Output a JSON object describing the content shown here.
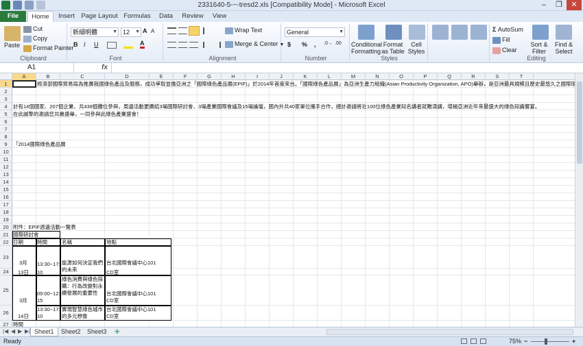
{
  "window": {
    "title": "2331640-5-~-tresd2.xls [Compatibility Mode] - Microsoft Excel",
    "minimize": "–",
    "restore": "❐",
    "close": "✕"
  },
  "tabs": {
    "file": "File",
    "home": "Home",
    "insert": "Insert",
    "page_layout": "Page Layout",
    "formulas": "Formulas",
    "data": "Data",
    "review": "Review",
    "view": "View"
  },
  "clipboard": {
    "paste": "Paste",
    "cut": "Cut",
    "copy": "Copy",
    "format_painter": "Format Painter",
    "label": "Clipboard"
  },
  "font": {
    "name": "新細明體",
    "size": "12",
    "bold": "B",
    "italic": "I",
    "underline": "U",
    "label": "Font"
  },
  "alignment": {
    "wrap": "Wrap Text",
    "merge": "Merge & Center",
    "label": "Alignment"
  },
  "number": {
    "format": "General",
    "currency": "$",
    "percent": "%",
    "comma": ",",
    "label": "Number"
  },
  "styles": {
    "conditional": "Conditional Formatting",
    "table": "Format as Table",
    "cell": "Cell Styles",
    "label": "Styles"
  },
  "cells": {
    "r1": "經濟部國際貿易局為推廣我國綠色產品及服務，成功爭取並擔亞洲之「國際綠色產品展(EPIF)」於2014年首度來台。「國際綠色產品展」為亞洲生產力組織(Asian Productivity Organization, APO)舉辦，是亞洲最具規模且歷史最悠久之國際環保展，本",
    "r4": "計有14個國家、207個企業、共438個攤位參與，周邊活動更廣結3場國際研討會、3場產業國際會議及15場論壇，國內外共40家單位攜手合作，總計邀請將近100位綠色產業知名講者就難演講，堪稱亞洲近年來最盛大的綠色知識饗宴。",
    "r5": "在此誠摯的邀請您共襄盛舉，一同參與此綠色產業盛會！",
    "r9": "「2014國際綠色產品展",
    "r20": "附件：EPIF週邊活動一覽表",
    "r21": "國際研討會",
    "h_date": "日期",
    "h_time": "時間",
    "h_name": "名稱",
    "h_place": "地點",
    "d1": "3月",
    "d2": "13日",
    "t1": "13:30~17:",
    "t1b": "10",
    "n1": "能源如何決定我們的未來",
    "p1": "台北國際會議中心101",
    "p1b": "CD室",
    "n2": "綠色消費與綠色採購：行為改變對永續發展的重要性",
    "t2": "09:00~12:",
    "t2b": "15",
    "d3": "3月",
    "p2": "台北國際會議中心101",
    "p2b": "CD室",
    "t3": "13:30~17:",
    "t3b": "10",
    "d4": "14日",
    "n3": "實現智慧綠色城市的多元想像",
    "p3": "台北國際會議中心101",
    "p3b": "CD室",
    "r27": "時間"
  },
  "editing": {
    "autosum": "AutoSum",
    "fill": "Fill",
    "clear": "Clear",
    "sort": "Sort & Filter",
    "find": "Find & Select",
    "label": "Editing"
  },
  "formula_bar": {
    "name_box": "A1",
    "fx": "fx",
    "formula": ""
  },
  "columns": [
    "A",
    "B",
    "C",
    "D",
    "E",
    "F",
    "G",
    "H",
    "I",
    "J",
    "K",
    "L",
    "M",
    "N",
    "O",
    "P",
    "Q",
    "R",
    "S",
    "T"
  ],
  "rows": [
    "1",
    "2",
    "3",
    "4",
    "5",
    "6",
    "7",
    "8",
    "9",
    "10",
    "11",
    "12",
    "13",
    "14",
    "15",
    "16",
    "17",
    "18",
    "19",
    "20",
    "21",
    "22",
    "23",
    "24",
    "25",
    "26",
    "27"
  ],
  "sheets": [
    "Sheet1",
    "Sheet2",
    "Sheet3"
  ],
  "status": {
    "ready": "Ready",
    "zoom": "75%",
    "zoom_minus": "−",
    "zoom_plus": "+"
  }
}
